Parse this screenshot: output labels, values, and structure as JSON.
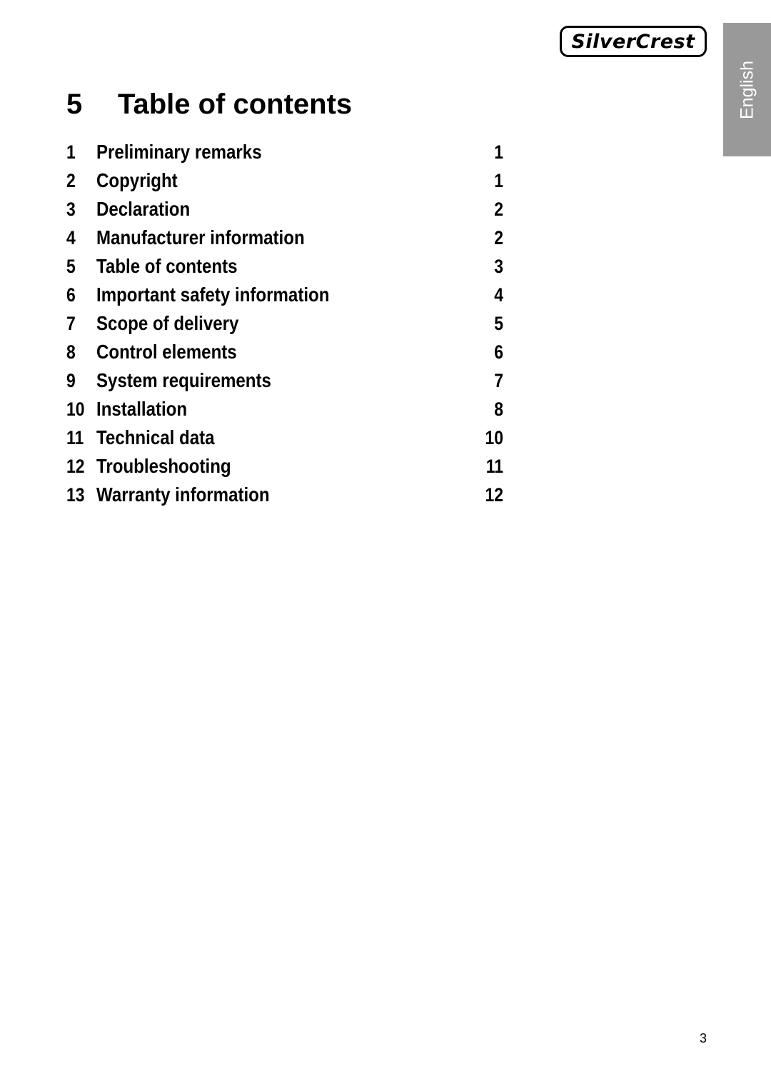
{
  "brand": {
    "logo_text": "SilverCrest"
  },
  "language_tab": "English",
  "heading": {
    "number": "5",
    "title": "Table of contents"
  },
  "toc": [
    {
      "num": "1",
      "title": "Preliminary remarks",
      "page": "1"
    },
    {
      "num": "2",
      "title": "Copyright",
      "page": "1"
    },
    {
      "num": "3",
      "title": "Declaration",
      "page": "2"
    },
    {
      "num": "4",
      "title": "Manufacturer information",
      "page": "2"
    },
    {
      "num": "5",
      "title": "Table of contents",
      "page": "3"
    },
    {
      "num": "6",
      "title": "Important safety information",
      "page": "4"
    },
    {
      "num": "7",
      "title": "Scope of delivery",
      "page": "5"
    },
    {
      "num": "8",
      "title": "Control elements",
      "page": "6"
    },
    {
      "num": "9",
      "title": "System requirements",
      "page": "7"
    },
    {
      "num": "10",
      "title": "Installation",
      "page": "8"
    },
    {
      "num": "11",
      "title": "Technical data",
      "page": "10"
    },
    {
      "num": "12",
      "title": "Troubleshooting",
      "page": "11"
    },
    {
      "num": "13",
      "title": "Warranty information",
      "page": "12"
    }
  ],
  "footer": {
    "page_number": "3"
  }
}
